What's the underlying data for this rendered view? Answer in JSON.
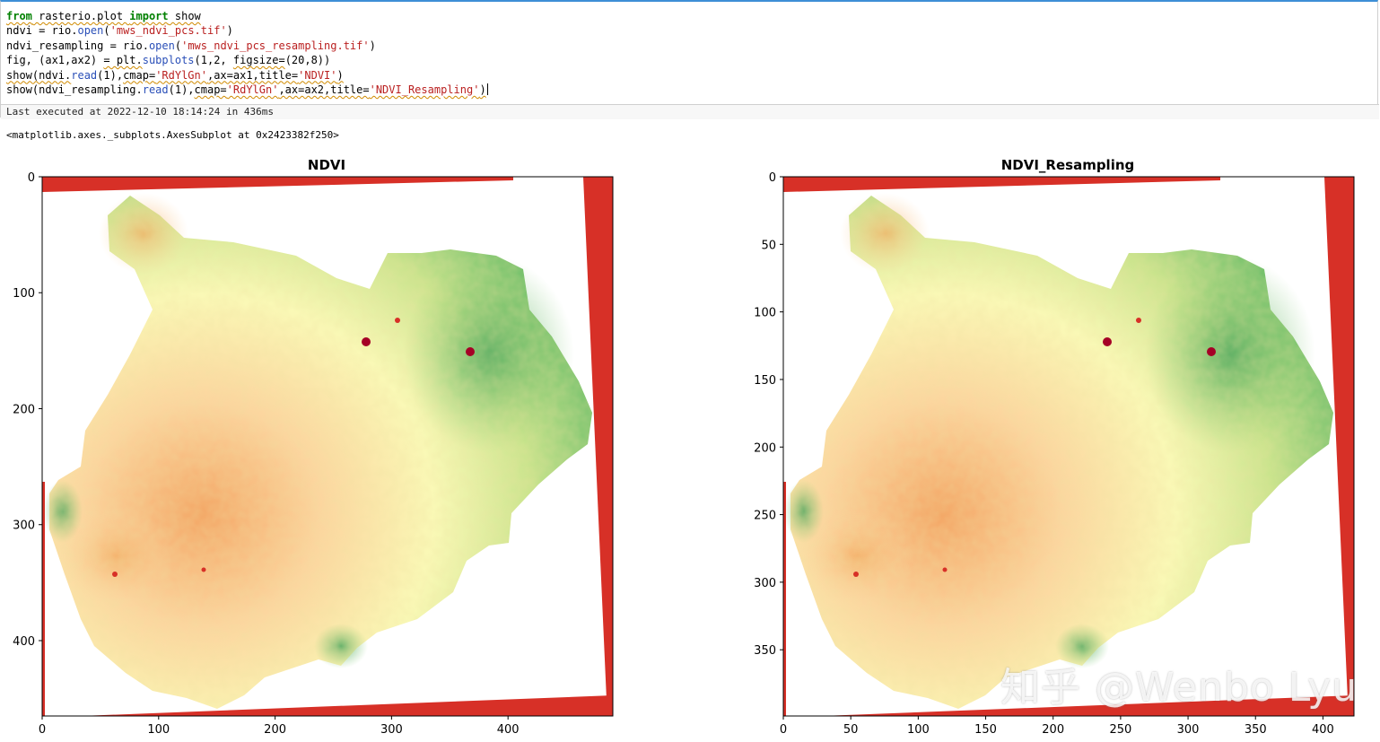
{
  "cell": {
    "code_lines": [
      "from rasterio.plot import show",
      "ndvi = rio.open('mws_ndvi_pcs.tif')",
      "ndvi_resampling = rio.open('mws_ndvi_pcs_resampling.tif')",
      "fig, (ax1,ax2) = plt.subplots(1,2, figsize=(20,8))",
      "show(ndvi.read(1),cmap='RdYlGn',ax=ax1,title='NDVI')",
      "show(ndvi_resampling.read(1),cmap='RdYlGn',ax=ax2,title='NDVI_Resampling')"
    ],
    "exec_status": "Last executed at 2022-12-10 18:14:24 in 436ms"
  },
  "output": {
    "text": "<matplotlib.axes._subplots.AxesSubplot at 0x2423382f250>"
  },
  "watermark": "知乎 @Wenbo Lyu",
  "colors": {
    "accent": "#3d8fd6",
    "nodata_red": "#d73027",
    "ndvi_low": "#f4a261",
    "ndvi_mid": "#ffffbf",
    "ndvi_high": "#1a9850"
  },
  "chart_data": [
    {
      "type": "heatmap",
      "title": "NDVI",
      "colormap": "RdYlGn",
      "xlim": [
        0,
        490
      ],
      "ylim": [
        465,
        0
      ],
      "xticks": [
        0,
        100,
        200,
        300,
        400
      ],
      "yticks": [
        0,
        100,
        200,
        300,
        400
      ],
      "grid": false
    },
    {
      "type": "heatmap",
      "title": "NDVI_Resampling",
      "colormap": "RdYlGn",
      "xlim": [
        0,
        423
      ],
      "ylim": [
        399,
        0
      ],
      "xticks": [
        0,
        50,
        100,
        150,
        200,
        250,
        300,
        350,
        400
      ],
      "yticks": [
        0,
        50,
        100,
        150,
        200,
        250,
        300,
        350
      ],
      "grid": false
    }
  ]
}
